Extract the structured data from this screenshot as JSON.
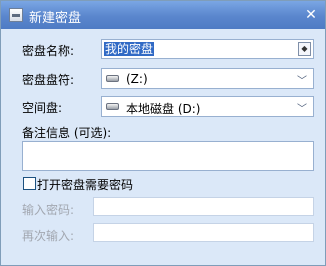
{
  "window": {
    "title": "新建密盘"
  },
  "form": {
    "name_label": "密盘名称:",
    "name_value": "我的密盘",
    "letter_label": "密盘盘符:",
    "letter_value": "(Z:)",
    "space_label": "空间盘:",
    "space_value": "本地磁盘 (D:)",
    "note_label": "备注信息 (可选):",
    "note_value": "",
    "require_password_label": "打开密盘需要密码",
    "require_password_checked": false,
    "password_label": "输入密码:",
    "password_value": "",
    "confirm_label": "再次输入:",
    "confirm_value": ""
  },
  "icons": {
    "app": "disk-icon",
    "close": "close-icon",
    "drive": "drive-icon",
    "dropdown": "chevron-down-icon"
  }
}
